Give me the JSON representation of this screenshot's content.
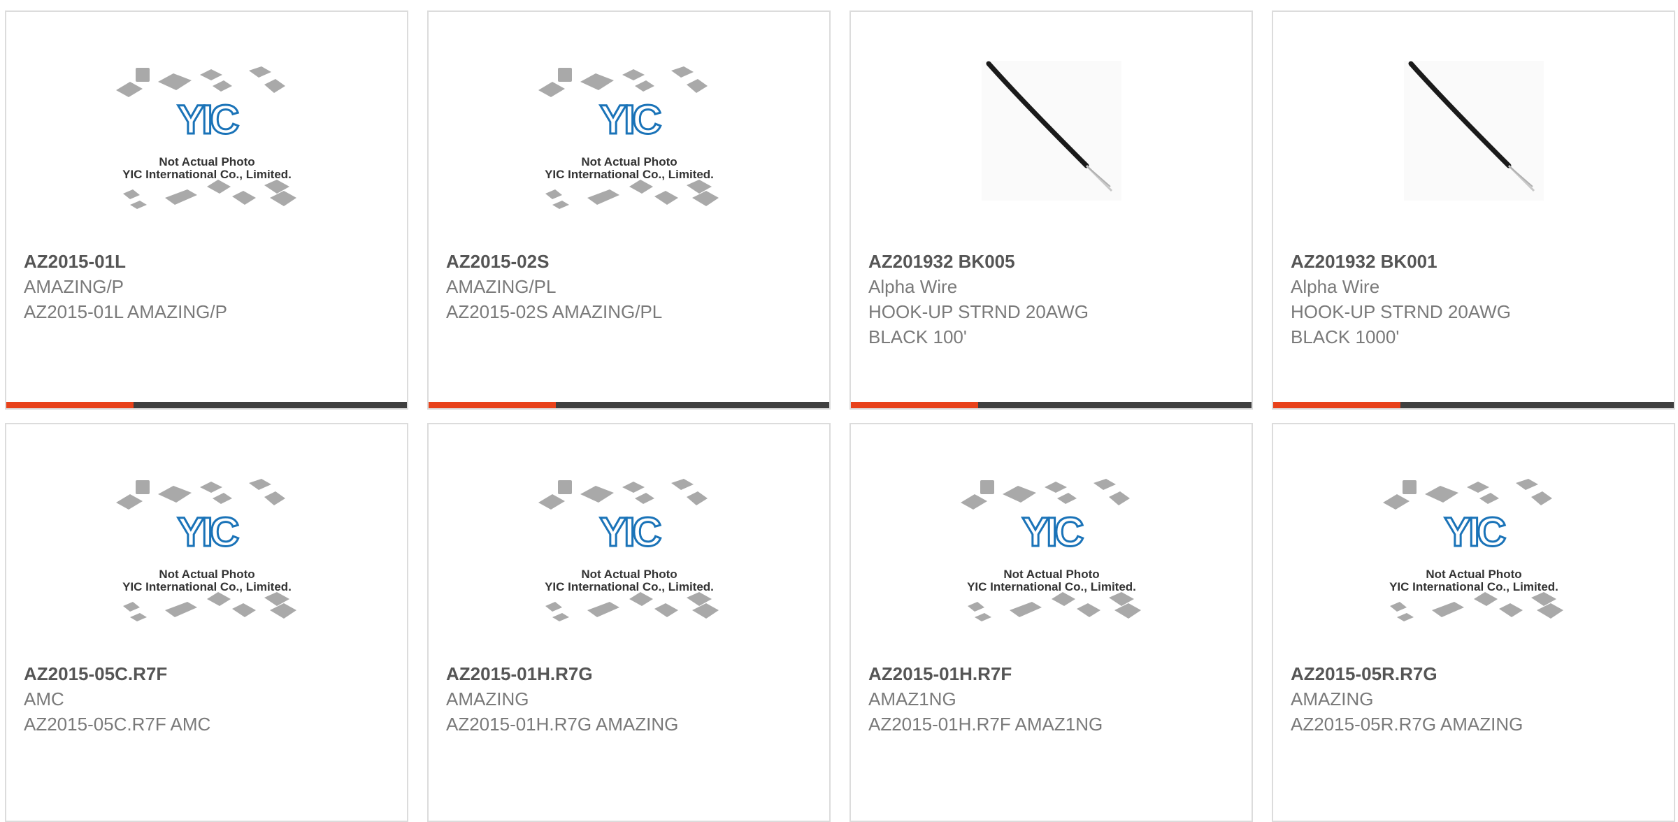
{
  "products": [
    {
      "part": "AZ2015-01L",
      "maker": "AMAZING/P",
      "desc": "AZ2015-01L AMAZING/P",
      "desc2": "",
      "image": "placeholder-icon"
    },
    {
      "part": "AZ2015-02S",
      "maker": "AMAZING/PL",
      "desc": "AZ2015-02S AMAZING/PL",
      "desc2": "",
      "image": "placeholder-icon"
    },
    {
      "part": "AZ201932 BK005",
      "maker": "Alpha Wire",
      "desc": "HOOK-UP STRND 20AWG",
      "desc2": "BLACK 100'",
      "image": "wire-photo"
    },
    {
      "part": "AZ201932 BK001",
      "maker": "Alpha Wire",
      "desc": "HOOK-UP STRND 20AWG",
      "desc2": "BLACK 1000'",
      "image": "wire-photo"
    },
    {
      "part": "AZ2015-05C.R7F",
      "maker": "AMC",
      "desc": "AZ2015-05C.R7F AMC",
      "desc2": "",
      "image": "placeholder-icon"
    },
    {
      "part": "AZ2015-01H.R7G",
      "maker": "AMAZING",
      "desc": "AZ2015-01H.R7G AMAZING",
      "desc2": "",
      "image": "placeholder-icon"
    },
    {
      "part": "AZ2015-01H.R7F",
      "maker": "AMAZ1NG",
      "desc": "AZ2015-01H.R7F AMAZ1NG",
      "desc2": "",
      "image": "placeholder-icon"
    },
    {
      "part": "AZ2015-05R.R7G",
      "maker": "AMAZING",
      "desc": "AZ2015-05R.R7G AMAZING",
      "desc2": "",
      "image": "placeholder-icon"
    }
  ],
  "placeholder": {
    "logo": "YIC",
    "caption1": "Not Actual Photo",
    "caption2": "YIC International Co., Limited."
  },
  "colors": {
    "accent": "#e8421b",
    "bar": "#3f3f3f",
    "logo": "#1a73b8"
  }
}
